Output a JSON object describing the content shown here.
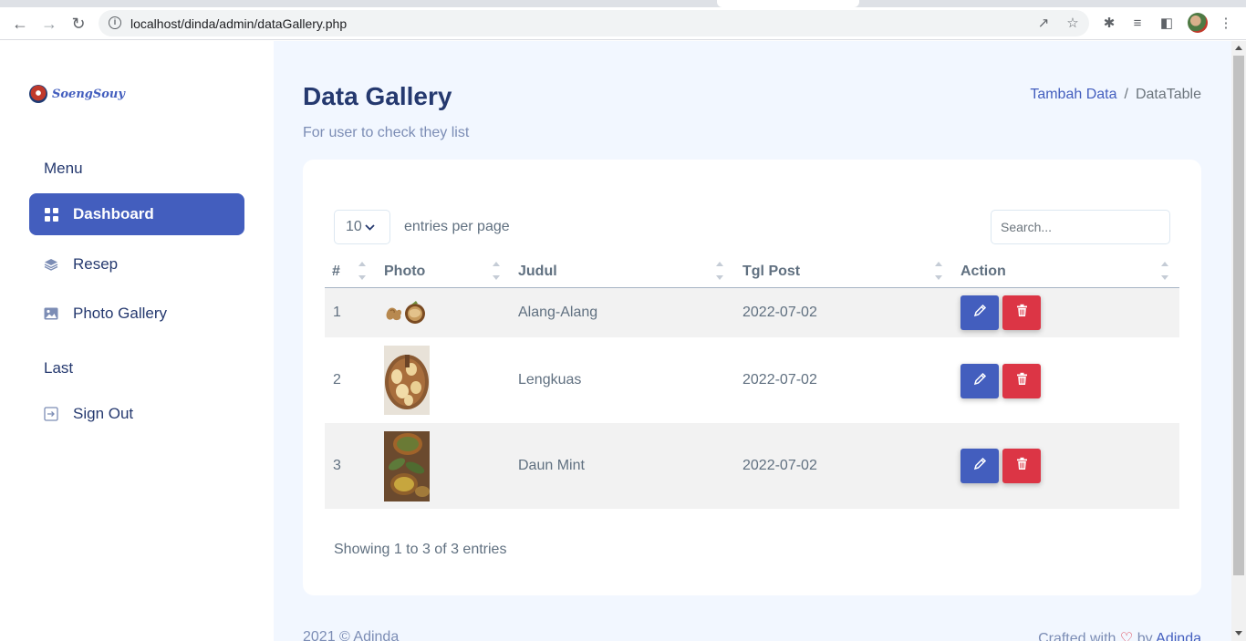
{
  "browser": {
    "url": "localhost/dinda/admin/dataGallery.php"
  },
  "sidebar": {
    "logo_text": "SoengSouy",
    "section_menu": "Menu",
    "section_last": "Last",
    "items": [
      {
        "label": "Dashboard",
        "icon": "grid-icon",
        "active": true
      },
      {
        "label": "Resep",
        "icon": "stack-icon",
        "active": false
      },
      {
        "label": "Photo Gallery",
        "icon": "image-icon",
        "active": false
      }
    ],
    "signout": {
      "label": "Sign Out",
      "icon": "signout-icon"
    }
  },
  "header": {
    "title": "Data Gallery",
    "subtitle": "For user to check they list",
    "breadcrumb": {
      "link": "Tambah Data",
      "separator": "/",
      "current": "DataTable"
    }
  },
  "table_controls": {
    "per_page_value": "10",
    "per_page_label": "entries per page",
    "search_placeholder": "Search..."
  },
  "table": {
    "columns": [
      "#",
      "Photo",
      "Judul",
      "Tgl Post",
      "Action"
    ],
    "rows": [
      {
        "no": "1",
        "judul": "Alang-Alang",
        "tgl_post": "2022-07-02",
        "photo": "ginger-photo"
      },
      {
        "no": "2",
        "judul": "Lengkuas",
        "tgl_post": "2022-07-02",
        "photo": "galangal-photo"
      },
      {
        "no": "3",
        "judul": "Daun Mint",
        "tgl_post": "2022-07-02",
        "photo": "bay-leaves-photo"
      }
    ],
    "info": "Showing 1 to 3 of 3 entries"
  },
  "footer": {
    "left": "2021 © Adinda",
    "right_prefix": "Crafted with",
    "right_by": "by",
    "right_author": "Adinda"
  },
  "colors": {
    "primary": "#435ebe",
    "danger": "#dc3545",
    "main_bg": "#f2f7ff",
    "text_dark": "#25396f"
  }
}
